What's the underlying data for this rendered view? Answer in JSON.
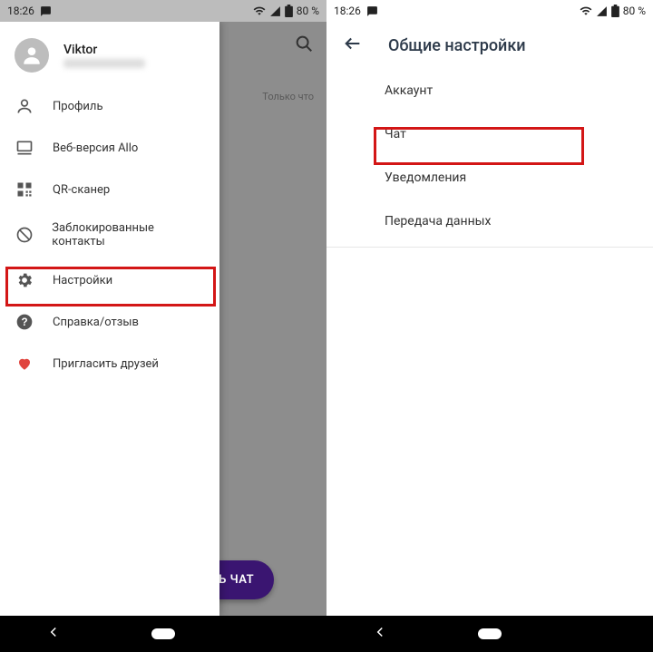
{
  "status": {
    "time": "18:26",
    "battery": "80 %"
  },
  "left": {
    "user_name": "Viktor",
    "drawer": {
      "profile": "Профиль",
      "web": "Веб-версия Allo",
      "qr": "QR-сканер",
      "blocked": "Заблокированные контакты",
      "settings": "Настройки",
      "help": "Справка/отзыв",
      "invite": "Пригласить друзей"
    },
    "timestamp_label": "Только что",
    "fab": "НАЧАТЬ ЧАТ"
  },
  "right": {
    "header": "Общие настройки",
    "items": {
      "account": "Аккаунт",
      "chat": "Чат",
      "notifications": "Уведомления",
      "data": "Передача данных"
    }
  }
}
